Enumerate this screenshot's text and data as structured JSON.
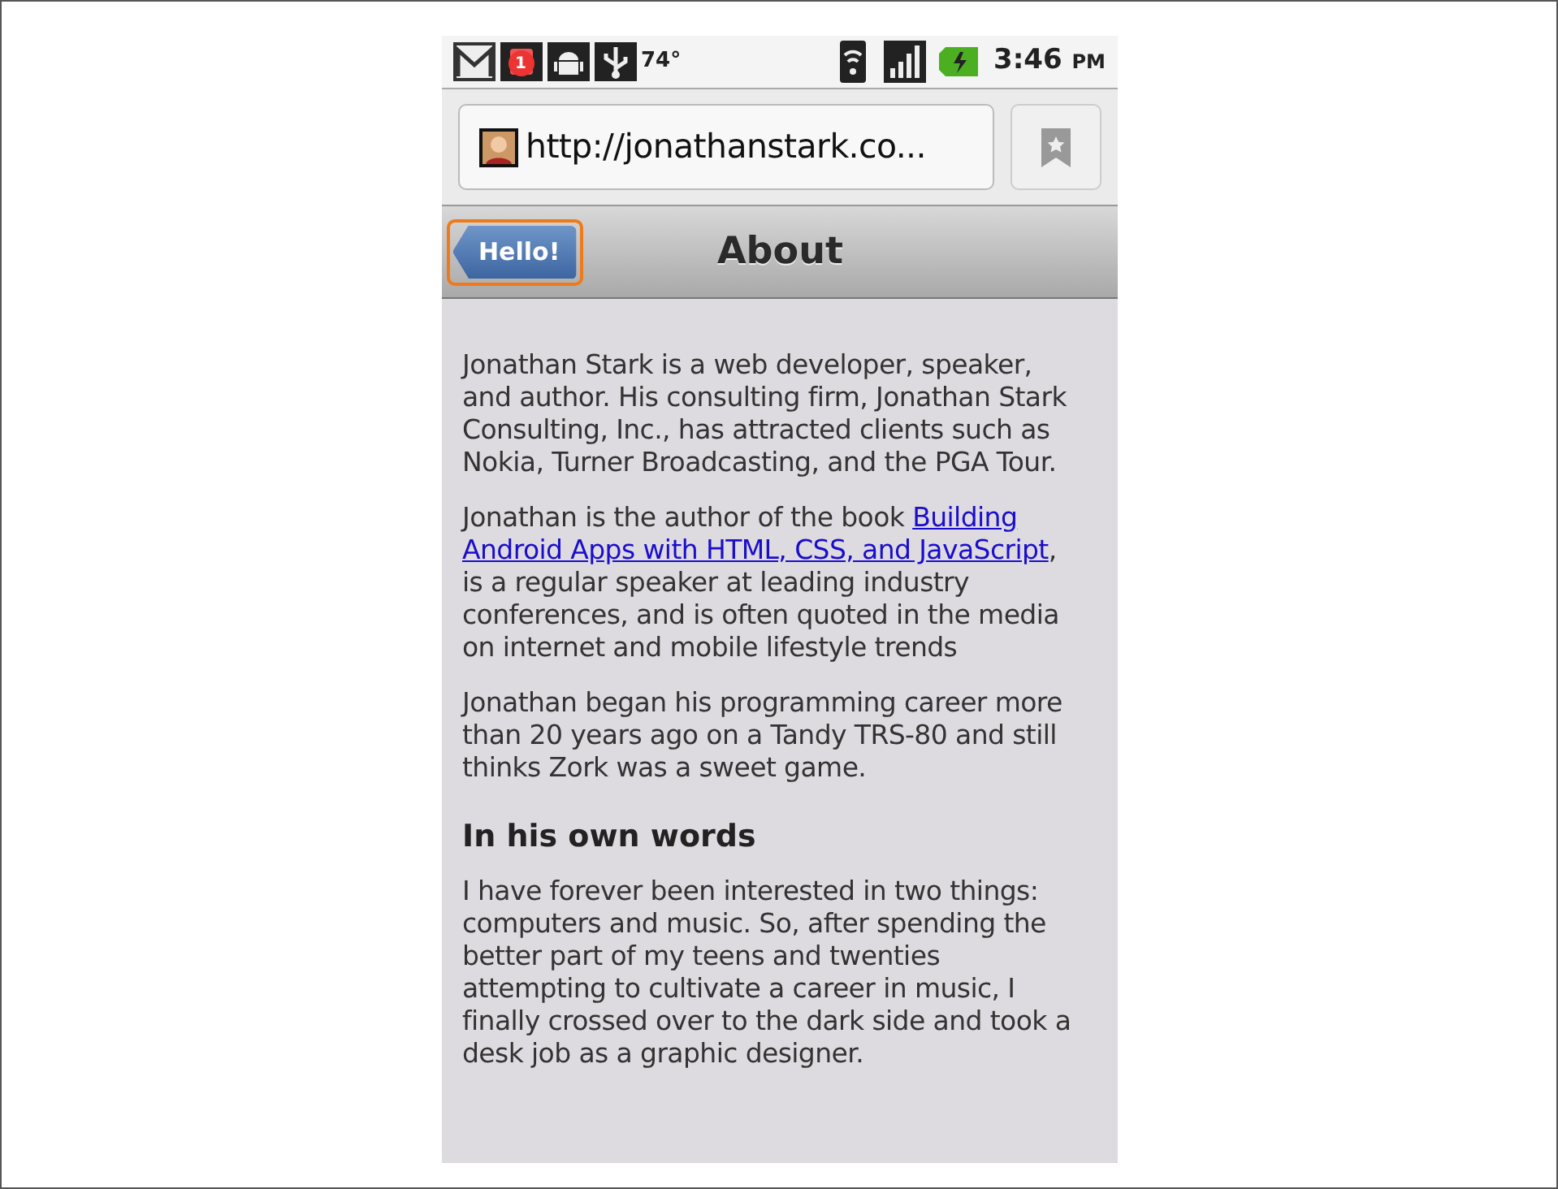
{
  "status_bar": {
    "notification_count": "1",
    "temperature": "74°",
    "time": "3:46",
    "meridiem": "PM"
  },
  "address_bar": {
    "url": "http://jonathanstark.co..."
  },
  "toolbar": {
    "back_button": {
      "label": "Hello!",
      "focused": true
    },
    "title": "About"
  },
  "content": [
    {
      "kind": "paragraph",
      "parts": [
        {
          "text": "Jonathan Stark is a web developer, speaker, and author. His consulting firm, Jonathan Stark Consulting, Inc., has attracted clients such as Nokia, Turner Broadcasting, and the PGA Tour."
        }
      ]
    },
    {
      "kind": "paragraph",
      "parts": [
        {
          "text": "Jonathan is the author of the book "
        },
        {
          "text": "Building",
          "link": true
        },
        {
          "text": "Android Apps with HTML, CSS, and JavaScript",
          "link": true
        },
        {
          "text": ", is a regular speaker at leading industry conferences, and is often quoted in the media on internet and mobile lifestyle trends"
        }
      ]
    },
    {
      "kind": "paragraph",
      "parts": [
        {
          "text": "Jonathan began his programming career more than 20 years ago on a Tandy TRS-80 and still thinks Zork was a sweet game."
        }
      ]
    },
    {
      "kind": "heading",
      "parts": [
        {
          "text": "In his own words"
        }
      ]
    },
    {
      "kind": "paragraph",
      "parts": [
        {
          "text": "I have forever been interested in two things: computers and music. So, after spending the better part of my teens and twenties attempting to cultivate a career in music, I finally crossed over to the dark side and took a desk job as a graphic designer."
        }
      ]
    }
  ]
}
